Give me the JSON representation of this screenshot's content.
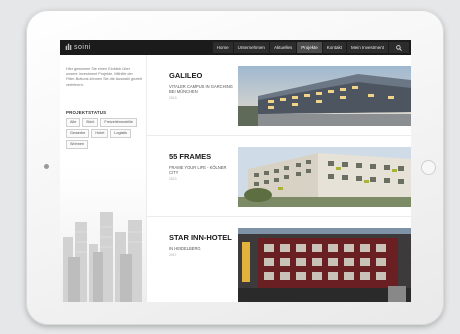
{
  "header": {
    "logo_text": "soini",
    "nav": [
      {
        "label": "Home",
        "active": false
      },
      {
        "label": "Unternehmen",
        "active": false
      },
      {
        "label": "Aktuelles",
        "active": false
      },
      {
        "label": "Projekte",
        "active": true
      },
      {
        "label": "Kontakt",
        "active": false
      },
      {
        "label": "Mein Investment",
        "active": false
      }
    ],
    "search_icon": "search-icon"
  },
  "sidebar": {
    "intro": "Hier gewinnen Sie einen Einblick über unsere Investment Projekte. Mithilfe der Filter-Buttons können Sie die Auswahl gezielt verfeinern.",
    "status_title": "PROJEKTSTATUS",
    "filters": [
      "Alle",
      "Bürö",
      "Freizeitimmobilie",
      "Gewerbe",
      "Hotel",
      "Logistik",
      "Wohnen"
    ]
  },
  "projects": [
    {
      "title": "GALILEO",
      "subtitle": "VITALER CAMPUS IN GARCHING BEI MÜNCHEN",
      "date": "2013"
    },
    {
      "title": "55 FRAMES",
      "subtitle": "FRAME YOUR LIFE - KÖLNER CITY",
      "date": "2013"
    },
    {
      "title": "STAR INN-HOTEL",
      "subtitle": "IN HEIDELBERG",
      "date": "2017"
    }
  ],
  "colors": {
    "nav_bg": "#1b1b1b",
    "nav_active": "#4b4b4b",
    "text_dark": "#1a1a1a"
  }
}
